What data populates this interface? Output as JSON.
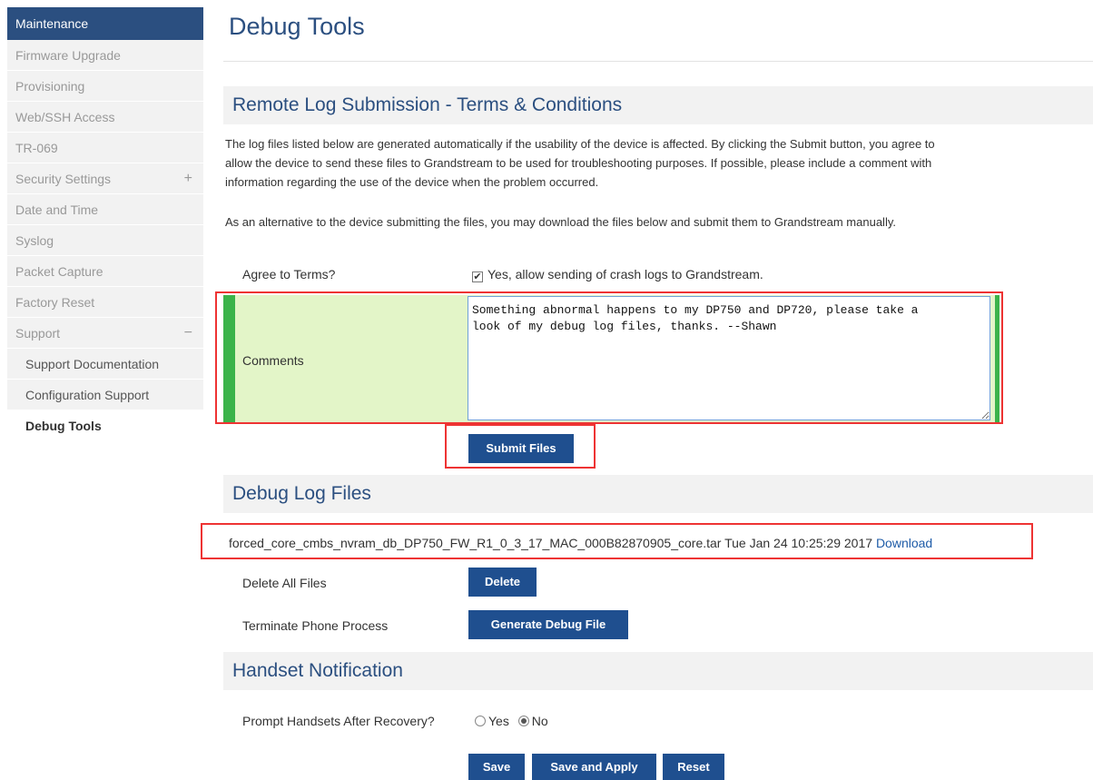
{
  "sidebar": {
    "header": "Maintenance",
    "items": [
      {
        "label": "Firmware Upgrade"
      },
      {
        "label": "Provisioning"
      },
      {
        "label": "Web/SSH Access"
      },
      {
        "label": "TR-069"
      },
      {
        "label": "Security Settings",
        "icon": "plus-icon",
        "icon_glyph": "+"
      },
      {
        "label": "Date and Time"
      },
      {
        "label": "Syslog"
      },
      {
        "label": "Packet Capture"
      },
      {
        "label": "Factory Reset"
      },
      {
        "label": "Support",
        "icon": "minus-icon",
        "icon_glyph": "−"
      }
    ],
    "sub_items": [
      {
        "label": "Support Documentation"
      },
      {
        "label": "Configuration Support"
      }
    ],
    "active_item": "Debug Tools"
  },
  "page": {
    "title": "Debug Tools"
  },
  "remote_log": {
    "title": "Remote Log Submission - Terms & Conditions",
    "para1_line1": "The log files listed below are generated automatically if the usability of the device is affected. By clicking the Submit button, you agree to",
    "para1_line2": "allow the device to send these files to Grandstream to be used for troubleshooting purposes. If possible, please include a comment with",
    "para1_line3": "information regarding the use of the device when the problem occurred.",
    "para2": "As an alternative to the device submitting the files, you may download the files below and submit them to Grandstream manually.",
    "agree_label": "Agree to Terms?",
    "agree_checkbox_label": "Yes, allow sending of crash logs to Grandstream.",
    "agree_checked": true,
    "comments_label": "Comments",
    "comments_value": "Something abnormal happens to my DP750 and DP720, please take a\nlook of my debug log files, thanks. --Shawn",
    "submit_label": "Submit Files"
  },
  "debug_log": {
    "title": "Debug Log Files",
    "file_name": "forced_core_cmbs_nvram_db_DP750_FW_R1_0_3_17_MAC_000B82870905_core.tar",
    "file_date": "Tue Jan 24 10:25:29 2017",
    "download_label": "Download",
    "delete_all_label": "Delete All Files",
    "delete_button": "Delete",
    "terminate_label": "Terminate Phone Process",
    "generate_button": "Generate Debug File"
  },
  "handset": {
    "title": "Handset Notification",
    "prompt_label": "Prompt Handsets After Recovery?",
    "option_yes": "Yes",
    "option_no": "No",
    "selected": "No"
  },
  "footer": {
    "save": "Save",
    "save_apply": "Save and Apply",
    "reset": "Reset"
  },
  "colors": {
    "brand": "#2b4f80",
    "button": "#1f4f8f",
    "highlight_red": "#e33333",
    "comments_bg": "#e3f5c8",
    "comments_accent": "#3bb34a"
  }
}
